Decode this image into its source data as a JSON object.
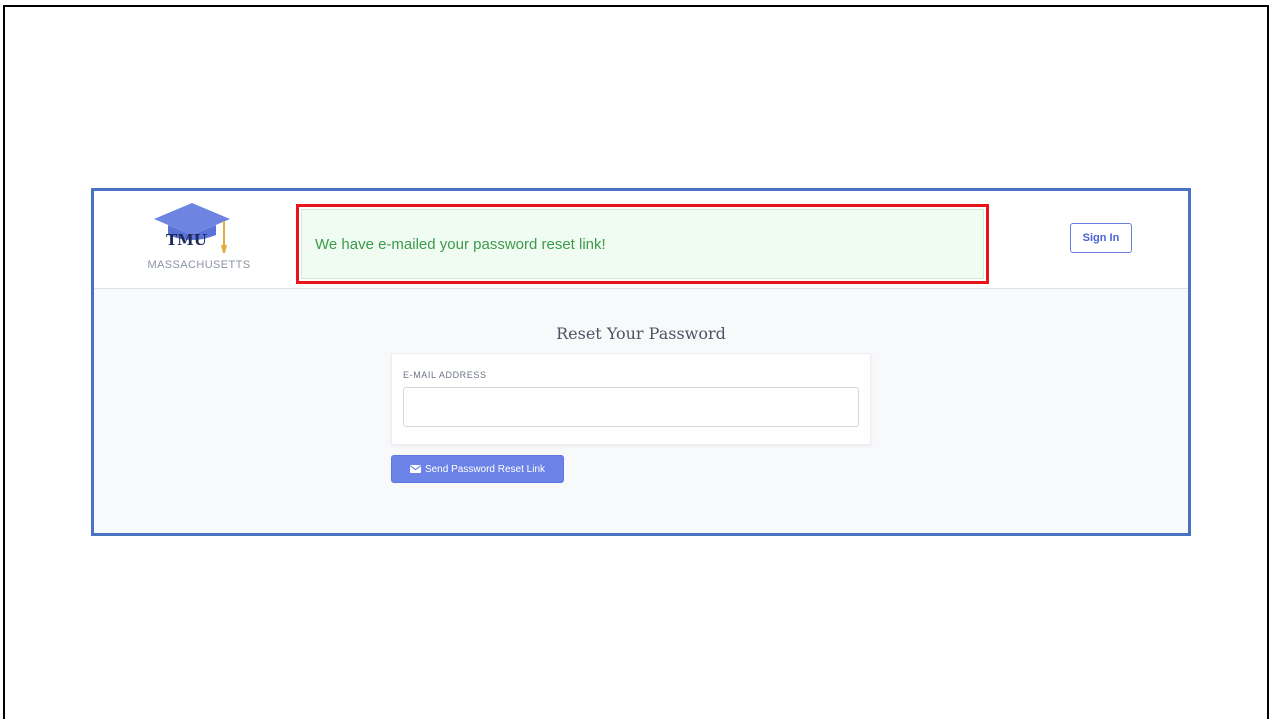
{
  "header": {
    "logo": {
      "text": "TMU",
      "subtitle": "MASSACHUSETTS",
      "icon": "graduation-cap-icon"
    },
    "alert": {
      "message": "We have e-mailed your password reset link!",
      "color": "#3c9a4c",
      "highlight_color": "#e8141a"
    },
    "sign_in_label": "Sign In"
  },
  "main": {
    "title": "Reset Your Password",
    "form": {
      "email_label": "E-MAIL ADDRESS",
      "email_value": "",
      "email_placeholder": ""
    },
    "submit": {
      "label": "Send Password Reset Link",
      "icon": "envelope-icon"
    }
  },
  "colors": {
    "accent": "#6b82e6",
    "frame": "#4a72c4"
  }
}
